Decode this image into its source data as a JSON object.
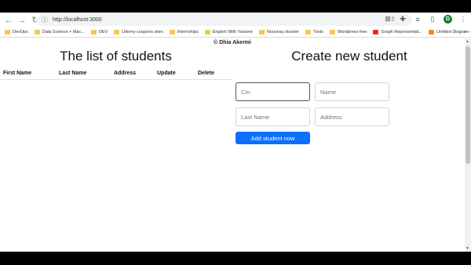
{
  "browser": {
    "url": "http://localhost:3000",
    "profile_initial": "D",
    "nav": {
      "back": "←",
      "forward": "→",
      "reload": "↻"
    },
    "bookmarks": [
      {
        "label": "DevOps",
        "icon": "folder-icon"
      },
      {
        "label": "Data Science + Mac...",
        "icon": "folder-icon"
      },
      {
        "label": "DEV",
        "icon": "folder-icon"
      },
      {
        "label": "Udemy coupons sites",
        "icon": "folder-icon"
      },
      {
        "label": "Internships",
        "icon": "folder-icon"
      },
      {
        "label": "English With Yassine",
        "icon": "folder-icon"
      },
      {
        "label": "Nouveau dossier",
        "icon": "folder-icon"
      },
      {
        "label": "Tools",
        "icon": "folder-icon"
      },
      {
        "label": "Wordpress free",
        "icon": "folder-icon"
      },
      {
        "label": "Graph Representati...",
        "icon": "youtube-icon"
      },
      {
        "label": "Untitled Diagram -...",
        "icon": "diagram-icon"
      }
    ],
    "bookmarks_more": "»"
  },
  "page": {
    "credit": "© Dhia Akermi",
    "list_title": "The list of students",
    "columns": [
      "First Name",
      "Last Name",
      "Address",
      "Update",
      "Delete"
    ],
    "create_title": "Create new student",
    "form": {
      "cin_placeholder": "Cin",
      "name_placeholder": "Name",
      "lastname_placeholder": "Last Name",
      "address_placeholder": "Address",
      "submit_label": "Add student now"
    }
  },
  "colors": {
    "primary_button": "#0d6efd",
    "profile_avatar": "#1e7b34"
  }
}
